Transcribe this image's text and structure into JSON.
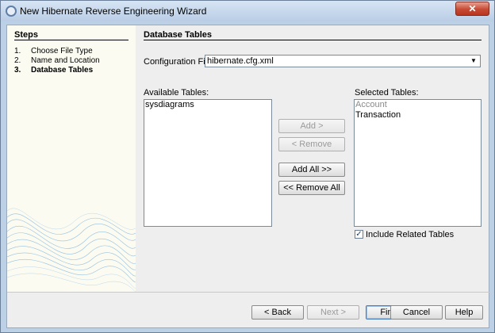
{
  "window": {
    "title": "New Hibernate Reverse Engineering Wizard",
    "close_glyph": "✕"
  },
  "steps": {
    "title": "Steps",
    "items": [
      {
        "num": "1.",
        "label": "Choose File Type"
      },
      {
        "num": "2.",
        "label": "Name and Location"
      },
      {
        "num": "3.",
        "label": "Database Tables",
        "current": true
      }
    ]
  },
  "main": {
    "title": "Database Tables",
    "config_label": "Configuration File:",
    "config_value": "hibernate.cfg.xml",
    "available_label": "Available Tables:",
    "available_tables": [
      "sysdiagrams"
    ],
    "selected_label": "Selected Tables:",
    "selected_tables": [
      {
        "name": "Account",
        "dimmed": true
      },
      {
        "name": "Transaction",
        "dimmed": false
      }
    ],
    "buttons": {
      "add": "Add >",
      "remove": "< Remove",
      "add_all": "Add All >>",
      "remove_all": "<< Remove All"
    },
    "include_related": {
      "label": "Include Related Tables",
      "checked": true
    }
  },
  "footer": {
    "back": "< Back",
    "next": "Next >",
    "finish": "Finish",
    "cancel": "Cancel",
    "help": "Help"
  },
  "colors": {
    "panel_bg": "#fbfbf1",
    "dialog_bg": "#eeeeee",
    "titlebar": "#b9cde5",
    "close": "#c74a33",
    "wave": "#7fb2d9"
  }
}
